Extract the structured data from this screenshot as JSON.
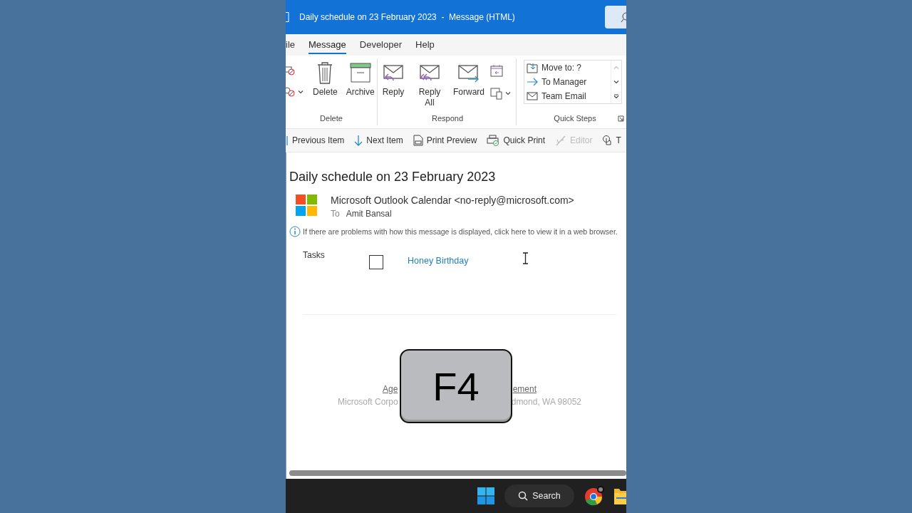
{
  "window": {
    "title": "Daily schedule on 23 February 2023  -  Message (HTML)"
  },
  "tabs": [
    {
      "label": "ile",
      "selected": false
    },
    {
      "label": "Message",
      "selected": true
    },
    {
      "label": "Developer",
      "selected": false
    },
    {
      "label": "Help",
      "selected": false
    }
  ],
  "ribbon": {
    "groups": [
      {
        "label": "Delete",
        "buttons": [
          {
            "label": "Delete",
            "kind": "delete"
          },
          {
            "label": "Archive",
            "kind": "archive"
          }
        ]
      },
      {
        "label": "Respond",
        "buttons": [
          {
            "label": "Reply",
            "kind": "reply"
          },
          {
            "label": "Reply All",
            "kind": "reply_all"
          },
          {
            "label": "Forward",
            "kind": "forward"
          }
        ]
      },
      {
        "label": "Quick Steps",
        "quick_steps": [
          {
            "label": "Move to: ?",
            "kind": "move"
          },
          {
            "label": "To Manager",
            "kind": "arrow"
          },
          {
            "label": "Team Email",
            "kind": "mail"
          }
        ]
      }
    ]
  },
  "toolbar": [
    {
      "label": "Previous Item",
      "kind": "previous",
      "disabled": false
    },
    {
      "label": "Next Item",
      "kind": "next",
      "disabled": false
    },
    {
      "label": "Print Preview",
      "kind": "preview",
      "disabled": false
    },
    {
      "label": "Quick Print",
      "kind": "print",
      "disabled": false
    },
    {
      "label": "Editor",
      "kind": "editor",
      "disabled": true
    },
    {
      "label": "T",
      "kind": "touch",
      "disabled": false
    }
  ],
  "message": {
    "subject": "Daily schedule on 23 February 2023",
    "sender": "Microsoft Outlook Calendar <no-reply@microsoft.com>",
    "to_label": "To",
    "recipient": "Amit Bansal",
    "info": "If there are problems with how this message is displayed, click here to view it in a web browser.",
    "tasks": {
      "label": "Tasks",
      "items": [
        {
          "title": "Honey Birthday",
          "checked": false
        }
      ]
    },
    "footer": {
      "links": [
        "Age",
        "ement"
      ],
      "address": [
        "Microsoft Corpo",
        "dmond, WA 98052"
      ]
    }
  },
  "key_overlay": "F4",
  "taskbar": {
    "search": "Search"
  }
}
